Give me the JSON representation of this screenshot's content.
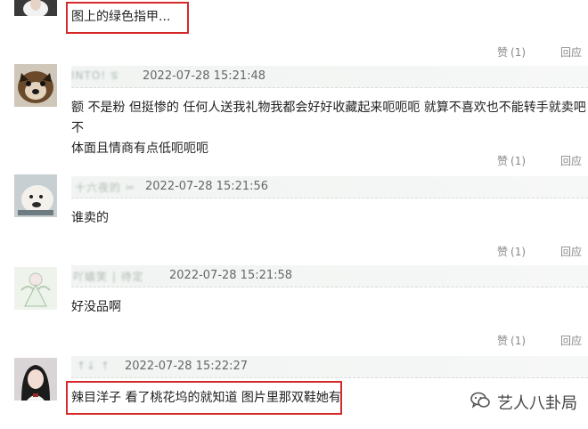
{
  "comments": [
    {
      "text": "图上的绿色指甲...",
      "actions": {
        "like_label": "赞",
        "like_count": "(1)",
        "reply_label": "回应"
      }
    },
    {
      "username": "INTO! 𝒢",
      "timestamp": "2022-07-28 15:21:48",
      "text_line1": "额 不是粉 但挺惨的 任何人送我礼物我都会好好收藏起来呃呃呃 就算不喜欢也不能转手就卖吧 不",
      "text_line2": "体面且情商有点低呃呃呃",
      "actions": {
        "like_label": "赞",
        "like_count": "(1)",
        "reply_label": "回应"
      }
    },
    {
      "username": "十六夜的 ✂",
      "timestamp": "2022-07-28 15:21:56",
      "text": "谁卖的",
      "actions": {
        "like_label": "赞",
        "like_count": "(1)",
        "reply_label": "回应"
      }
    },
    {
      "username": "吖嬉笑 | 待定",
      "timestamp": "2022-07-28 15:21:58",
      "text": "好没品啊",
      "actions": {
        "like_label": "赞",
        "like_count": "(1)",
        "reply_label": "回应"
      }
    },
    {
      "username": "↑↓ ↑",
      "timestamp": "2022-07-28 15:22:27",
      "text": "辣目洋子 看了桃花坞的就知道 图片里那双鞋她有"
    }
  ],
  "watermark": {
    "text": "艺人八卦局"
  },
  "colors": {
    "highlight": "#d52a2a",
    "meta_bg": "#f2f5f3"
  }
}
